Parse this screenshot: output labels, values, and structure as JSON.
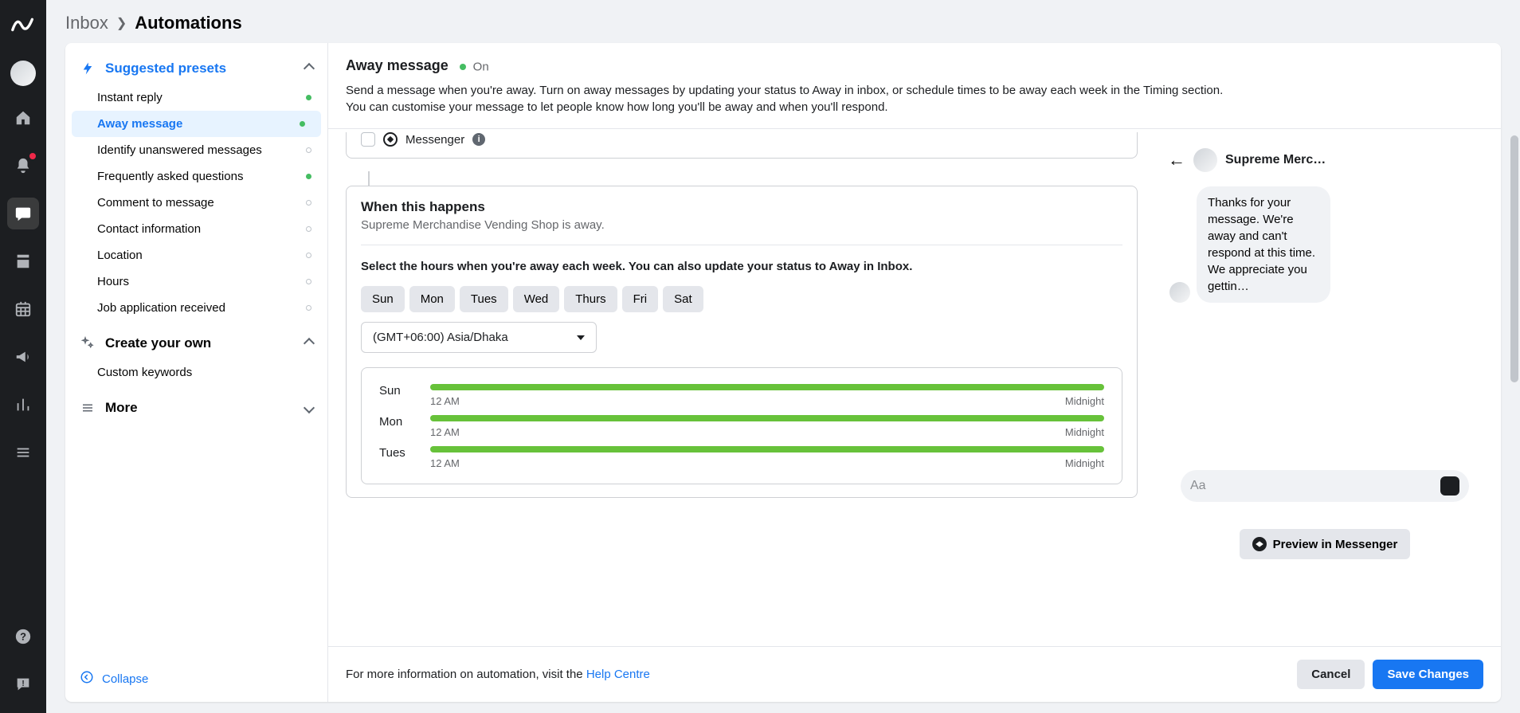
{
  "breadcrumb": {
    "parent": "Inbox",
    "current": "Automations"
  },
  "sidebar": {
    "group1_title": "Suggested presets",
    "items": [
      {
        "label": "Instant reply",
        "status": "green"
      },
      {
        "label": "Away message",
        "status": "green"
      },
      {
        "label": "Identify unanswered messages",
        "status": "empty"
      },
      {
        "label": "Frequently asked questions",
        "status": "green"
      },
      {
        "label": "Comment to message",
        "status": "empty"
      },
      {
        "label": "Contact information",
        "status": "empty"
      },
      {
        "label": "Location",
        "status": "empty"
      },
      {
        "label": "Hours",
        "status": "empty"
      },
      {
        "label": "Job application received",
        "status": "empty"
      }
    ],
    "group2_title": "Create your own",
    "custom_item": "Custom keywords",
    "group3_title": "More",
    "collapse": "Collapse"
  },
  "header": {
    "title": "Away message",
    "status": "On",
    "description": "Send a message when you're away. Turn on away messages by updating your status to Away in inbox, or schedule times to be away each week in the Timing section. You can customise your message to let people know how long you'll be away and when you'll respond."
  },
  "channel": {
    "messenger": "Messenger"
  },
  "when": {
    "title": "When this happens",
    "subtitle": "Supreme Merchandise Vending Shop is away.",
    "instruction": "Select the hours when you're away each week. You can also update your status to Away in Inbox.",
    "days_buttons": [
      "Sun",
      "Mon",
      "Tues",
      "Wed",
      "Thurs",
      "Fri",
      "Sat"
    ],
    "timezone": "(GMT+06:00) Asia/Dhaka",
    "schedule": [
      {
        "day": "Sun",
        "start": "12 AM",
        "end": "Midnight"
      },
      {
        "day": "Mon",
        "start": "12 AM",
        "end": "Midnight"
      },
      {
        "day": "Tues",
        "start": "12 AM",
        "end": "Midnight"
      }
    ]
  },
  "preview": {
    "shop_name": "Supreme Merc…",
    "message": "Thanks for your message. We're away and can't respond at this time. We appreciate you gettin…",
    "input_placeholder": "Aa",
    "button": "Preview in Messenger"
  },
  "footer": {
    "text_prefix": "For more information on automation, visit the ",
    "link": "Help Centre",
    "cancel": "Cancel",
    "save": "Save Changes"
  }
}
